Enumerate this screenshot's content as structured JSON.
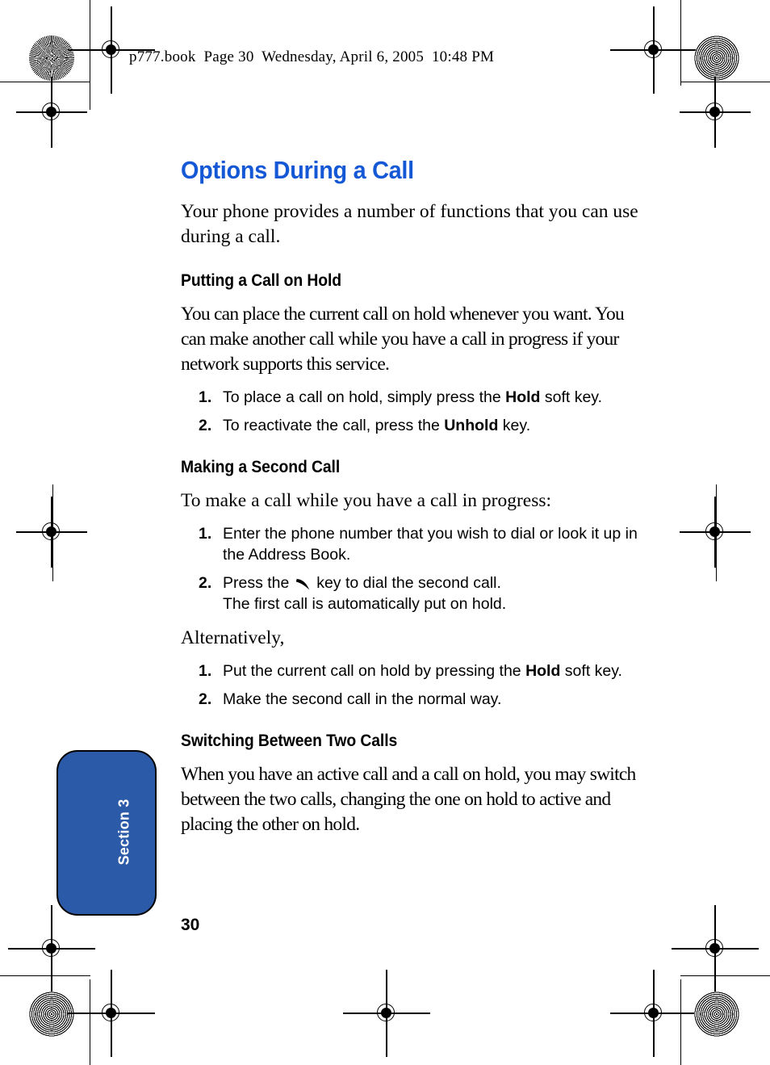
{
  "header": {
    "file_line": "p777.book  Page 30  Wednesday, April 6, 2005  10:48 PM"
  },
  "page": {
    "title": "Options During a Call",
    "intro": "Your phone provides a number of functions that you can use during a call.",
    "folio": "30"
  },
  "section_tab": {
    "label": "Section 3"
  },
  "sections": [
    {
      "heading": "Putting a Call on Hold",
      "body": "You can place the current call on hold whenever you want. You can make another call while you have a call in progress if your network supports this service.",
      "steps": [
        {
          "num": "1.",
          "pre": "To place a call on hold, simply press the ",
          "bold": "Hold",
          "post": " soft key."
        },
        {
          "num": "2.",
          "pre": "To reactivate the call, press the ",
          "bold": "Unhold",
          "post": " key."
        }
      ]
    },
    {
      "heading": "Making a Second Call",
      "body": "To make a call while you have a call in progress:",
      "steps": [
        {
          "num": "1.",
          "text": "Enter the phone number that you wish to dial or look it up in the Address Book."
        },
        {
          "num": "2.",
          "pre": "Press the ",
          "icon": "send-key-icon",
          "post": " key to dial the second call.",
          "sub": "The first call is automatically put on hold."
        }
      ],
      "alt_intro": "Alternatively,",
      "alt_steps": [
        {
          "num": "1.",
          "pre": "Put the current call on hold by pressing the ",
          "bold": "Hold",
          "post": " soft key."
        },
        {
          "num": "2.",
          "text": "Make the second call in the normal way."
        }
      ]
    },
    {
      "heading": "Switching Between Two Calls",
      "body": "When you have an active call and a call on hold, you may switch between the two calls, changing the one on hold to active and placing the other on hold."
    }
  ],
  "colors": {
    "title_blue": "#1558d6",
    "tab_blue": "#2a5aa8",
    "text_black": "#000000"
  }
}
